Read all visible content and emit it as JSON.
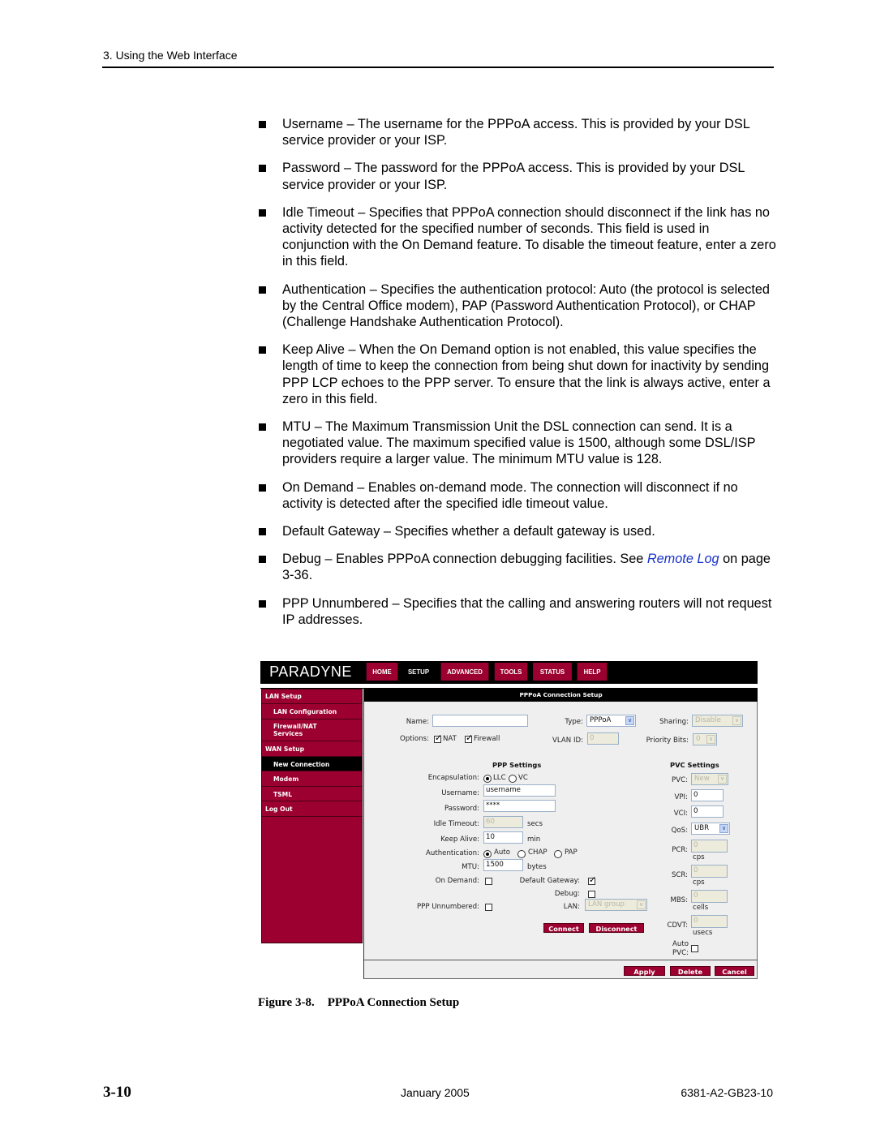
{
  "header": {
    "running_head": "3. Using the Web Interface"
  },
  "bullets": [
    {
      "text": "Username – The username for the PPPoA access. This is provided by your DSL service provider or your ISP."
    },
    {
      "text": "Password – The password for the PPPoA access. This is provided by your DSL service provider or your ISP."
    },
    {
      "text": "Idle Timeout – Specifies that PPPoA connection should disconnect if the link has no activity detected for the specified number of seconds. This field is used in conjunction with the On Demand feature. To disable the timeout feature, enter a zero in this field."
    },
    {
      "text": "Authentication – Specifies the authentication protocol: Auto (the protocol is selected by the Central Office modem), PAP (Password Authentication Protocol), or CHAP (Challenge Handshake Authentication Protocol)."
    },
    {
      "text": "Keep Alive – When the On Demand option is not enabled, this value specifies the length of time to keep the connection from being shut down for inactivity by sending PPP LCP echoes to the PPP server. To ensure that the link is always active, enter a zero in this field."
    },
    {
      "text": "MTU – The Maximum Transmission Unit the DSL connection can send. It is a negotiated value. The maximum specified value is 1500, although some DSL/ISP providers require a larger value. The minimum MTU value is 128."
    },
    {
      "text": "On Demand – Enables on-demand mode. The connection will disconnect if no activity is detected after the specified idle timeout value."
    },
    {
      "text": "Default Gateway – Specifies whether a default gateway is used."
    },
    {
      "text_before": "Debug – Enables PPPoA connection debugging facilities.  See ",
      "link": "Remote Log",
      "text_after": " on page 3-36."
    },
    {
      "text": "PPP Unnumbered – Specifies that the calling and answering routers will not request IP addresses."
    }
  ],
  "screenshot": {
    "logo": "PARADYNE",
    "nav": [
      "HOME",
      "SETUP",
      "ADVANCED",
      "TOOLS",
      "STATUS",
      "HELP"
    ],
    "nav_active": "SETUP",
    "sidebar": [
      {
        "label": "LAN Setup",
        "level": 0
      },
      {
        "label": "LAN Configuration",
        "level": 1
      },
      {
        "label": "Firewall/NAT Services",
        "level": 1
      },
      {
        "label": "WAN Setup",
        "level": 0
      },
      {
        "label": "New Connection",
        "level": 1,
        "active": true
      },
      {
        "label": "Modem",
        "level": 1
      },
      {
        "label": "TSML",
        "level": 1
      },
      {
        "label": "Log Out",
        "level": 0
      }
    ],
    "title": "PPPoA Connection Setup",
    "general": {
      "name_label": "Name:",
      "name_value": "",
      "type_label": "Type:",
      "type_value": "PPPoA",
      "sharing_label": "Sharing:",
      "sharing_value": "Disable",
      "options_label": "Options:",
      "nat_label": "NAT",
      "nat_checked": true,
      "firewall_label": "Firewall",
      "firewall_checked": true,
      "vlan_label": "VLAN ID:",
      "vlan_value": "0",
      "priority_label": "Priority Bits:",
      "priority_value": "0"
    },
    "ppp": {
      "heading": "PPP Settings",
      "encapsulation_label": "Encapsulation:",
      "encap_options": [
        "LLC",
        "VC"
      ],
      "encap_selected": "LLC",
      "username_label": "Username:",
      "username_value": "username",
      "password_label": "Password:",
      "password_value": "****",
      "idle_label": "Idle Timeout:",
      "idle_value": "60",
      "idle_unit": "secs",
      "keepalive_label": "Keep Alive:",
      "keepalive_value": "10",
      "keepalive_unit": "min",
      "auth_label": "Authentication:",
      "auth_options": [
        "Auto",
        "CHAP",
        "PAP"
      ],
      "auth_selected": "Auto",
      "mtu_label": "MTU:",
      "mtu_value": "1500",
      "mtu_unit": "bytes",
      "ondemand_label": "On Demand:",
      "ondemand_checked": false,
      "gateway_label": "Default Gateway:",
      "gateway_checked": true,
      "debug_label": "Debug:",
      "debug_checked": false,
      "unnumbered_label": "PPP Unnumbered:",
      "unnumbered_checked": false,
      "lan_label": "LAN:",
      "lan_value": "LAN group",
      "connect_label": "Connect",
      "disconnect_label": "Disconnect"
    },
    "pvc": {
      "heading": "PVC Settings",
      "pvc_label": "PVC:",
      "pvc_value": "New",
      "vpi_label": "VPI:",
      "vpi_value": "0",
      "vci_label": "VCI:",
      "vci_value": "0",
      "qos_label": "QoS:",
      "qos_value": "UBR",
      "pcr_label": "PCR:",
      "pcr_value": "0",
      "pcr_unit": "cps",
      "scr_label": "SCR:",
      "scr_value": "0",
      "scr_unit": "cps",
      "mbs_label": "MBS:",
      "mbs_value": "0",
      "mbs_unit": "cells",
      "cdvt_label": "CDVT:",
      "cdvt_value": "0",
      "cdvt_unit": "usecs",
      "autopvc_label_1": "Auto",
      "autopvc_label_2": "PVC:",
      "autopvc_checked": false
    },
    "footer_buttons": [
      "Apply",
      "Delete",
      "Cancel"
    ]
  },
  "figure": {
    "number": "Figure 3-8.",
    "title": "PPPoA Connection Setup"
  },
  "footer": {
    "page_number": "3-10",
    "date": "January 2005",
    "doc_number": "6381-A2-GB23-10"
  },
  "colors": {
    "brand": "#9b0030",
    "link": "#1a33cc"
  }
}
